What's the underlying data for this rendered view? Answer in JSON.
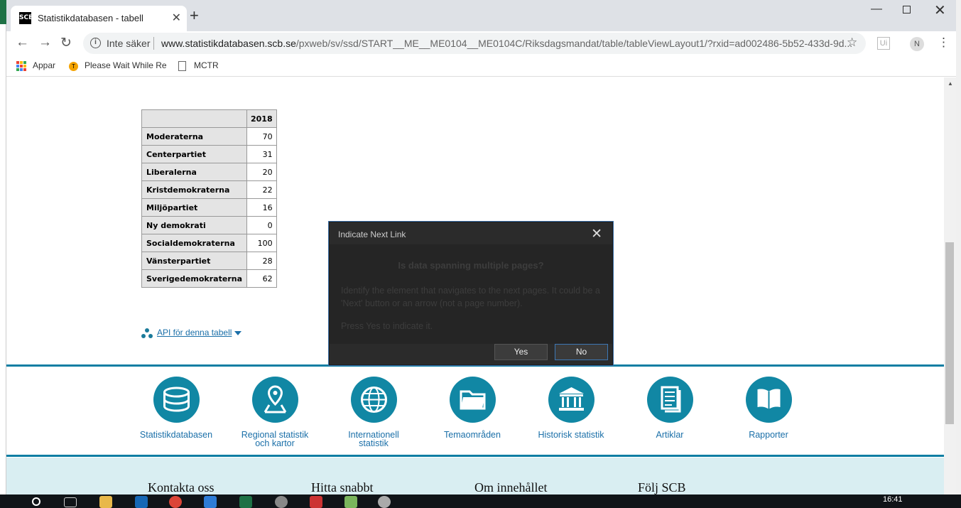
{
  "browser": {
    "tab_title": "Statistikdatabasen - tabell",
    "tab_close": "✕",
    "new_tab": "+",
    "favicon_text": "SCB",
    "window_min": "—",
    "window_close": "✕",
    "security_label": "Inte säker",
    "url_host": "www.statistikdatabasen.scb.se",
    "url_path": "/pxweb/sv/ssd/START__ME__ME0104__ME0104C/Riksdagsmandat/table/tableViewLayout1/?rxid=ad002486-5b52-433d-9d...",
    "back_icon": "←",
    "forward_icon": "→",
    "reload_icon": "↻",
    "star_icon": "☆",
    "ext_label": "Ui",
    "avatar_initial": "N",
    "menu_icon": "⋮"
  },
  "bookmarks": [
    {
      "label": "Appar"
    },
    {
      "label": "Please Wait While Re"
    },
    {
      "label": "MCTR"
    }
  ],
  "table": {
    "year": "2018",
    "rows": [
      {
        "party": "Moderaterna",
        "value": "70"
      },
      {
        "party": "Centerpartiet",
        "value": "31"
      },
      {
        "party": "Liberalerna",
        "value": "20"
      },
      {
        "party": "Kristdemokraterna",
        "value": "22"
      },
      {
        "party": "Miljöpartiet",
        "value": "16"
      },
      {
        "party": "Ny demokrati",
        "value": "0"
      },
      {
        "party": "Socialdemokraterna",
        "value": "100"
      },
      {
        "party": "Vänsterpartiet",
        "value": "28"
      },
      {
        "party": "Sverigedemokraterna",
        "value": "62"
      }
    ]
  },
  "api_link": "API för denna tabell",
  "nav_tiles": [
    {
      "l1": "Statistikdatabasen",
      "l2": "",
      "icon": "database-icon"
    },
    {
      "l1": "Regional statistik",
      "l2": "och kartor",
      "icon": "map-pin-icon"
    },
    {
      "l1": "Internationell",
      "l2": "statistik",
      "icon": "globe-icon"
    },
    {
      "l1": "Temaområden",
      "l2": "",
      "icon": "folder-icon"
    },
    {
      "l1": "Historisk statistik",
      "l2": "",
      "icon": "building-icon"
    },
    {
      "l1": "Artiklar",
      "l2": "",
      "icon": "document-icon"
    },
    {
      "l1": "Rapporter",
      "l2": "",
      "icon": "book-icon"
    }
  ],
  "footer": {
    "col1": "Kontakta oss",
    "col2": "Hitta snabbt",
    "col3": "Om innehållet",
    "col4": "Följ SCB"
  },
  "modal": {
    "title": "Indicate Next Link",
    "close": "✕",
    "question": "Is data spanning multiple pages?",
    "text1": "Identify the element that navigates to the next pages. It could be a 'Next' button or an arrow (not a page number).",
    "text2": "Press Yes to indicate it.",
    "yes": "Yes",
    "no": "No"
  },
  "taskbar": {
    "clock": "16:41"
  },
  "colors": {
    "accent": "#1187a4",
    "link": "#1a6fa8",
    "footer_bg": "#d9eef2"
  }
}
